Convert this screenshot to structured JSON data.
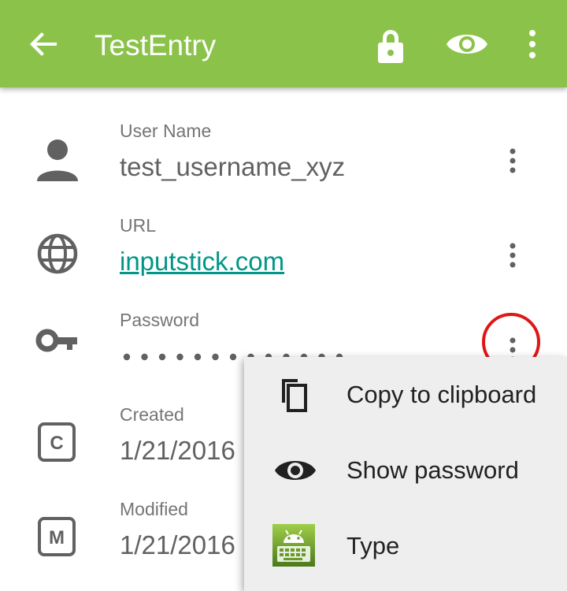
{
  "toolbar": {
    "title": "TestEntry",
    "back_icon": "arrow-back-icon",
    "lock_icon": "lock-icon",
    "eye_icon": "eye-icon",
    "overflow_icon": "more-vert-icon",
    "color": "#8bc34a"
  },
  "fields": [
    {
      "label": "User Name",
      "value": "test_username_xyz",
      "icon": "person-icon"
    },
    {
      "label": "URL",
      "value": "inputstick.com",
      "icon": "globe-icon"
    },
    {
      "label": "Password",
      "value": "",
      "masked_dots": 13,
      "icon": "key-icon"
    },
    {
      "label": "Created",
      "value": "1/21/2016",
      "icon": "created-c-icon",
      "icon_letter": "C"
    },
    {
      "label": "Modified",
      "value": "1/21/2016",
      "icon": "modified-m-icon",
      "icon_letter": "M"
    }
  ],
  "popup_menu": {
    "items": [
      {
        "label": "Copy to clipboard",
        "icon": "copy-icon"
      },
      {
        "label": "Show password",
        "icon": "eye-icon"
      },
      {
        "label": "Type",
        "icon": "android-keyboard-icon"
      }
    ]
  },
  "colors": {
    "link": "#009688",
    "highlight": "#e01616",
    "icon": "#616161"
  }
}
